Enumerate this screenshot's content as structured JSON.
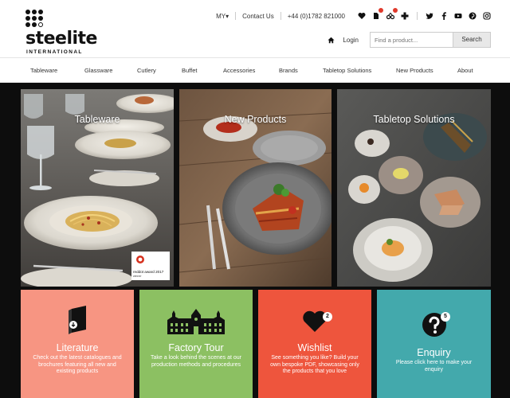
{
  "brand": {
    "name": "steelite",
    "sub": "INTERNATIONAL"
  },
  "topbar": {
    "region": "MY",
    "contact": "Contact Us",
    "phone": "+44 (0)1782 821000"
  },
  "account": {
    "login": "Login",
    "search_placeholder": "Find a product...",
    "search_button": "Search"
  },
  "nav": [
    "Tableware",
    "Glassware",
    "Cutlery",
    "Buffet",
    "Accessories",
    "Brands",
    "Tabletop Solutions",
    "New Products",
    "About"
  ],
  "panels": [
    {
      "title": "Tableware",
      "award": {
        "line1": "reddot award 2017",
        "line2": "winner"
      }
    },
    {
      "title": "New Products"
    },
    {
      "title": "Tabletop Solutions"
    }
  ],
  "tiles": [
    {
      "title": "Literature",
      "desc": "Check out the latest catalogues and brochures featuring all new and existing products",
      "color": "#f79582"
    },
    {
      "title": "Factory Tour",
      "desc": "Take a look behind the scenes at our production methods and procedures",
      "color": "#8cc062"
    },
    {
      "title": "Wishlist",
      "badge": "2",
      "desc": "See something you like? Build your own bespoke PDF, showcasing only the products that you love",
      "color": "#ee553d"
    },
    {
      "title": "Enquiry",
      "badge": "5",
      "desc": "Please click here to make your enquiry",
      "color": "#43a9ac"
    }
  ]
}
